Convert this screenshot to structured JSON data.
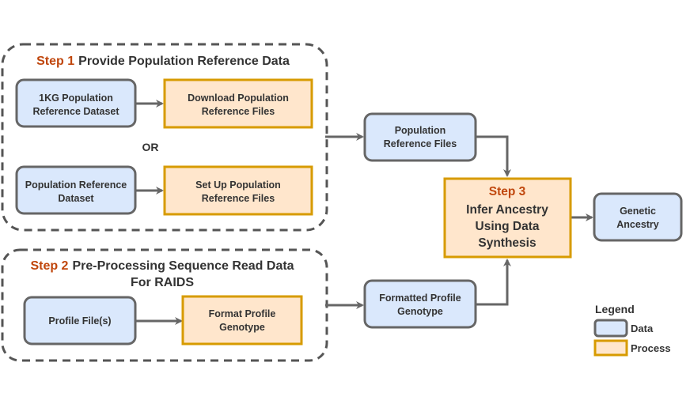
{
  "groups": {
    "step1": {
      "step": "Step 1",
      "title": "Provide Population Reference Data",
      "or_label": "OR"
    },
    "step2": {
      "step": "Step 2",
      "title_line1": "Pre-Processing Sequence Read Data",
      "title_line2": "For RAIDS"
    }
  },
  "nodes": {
    "kg_dataset": {
      "type": "data",
      "lines": [
        "1KG Population",
        "Reference Dataset"
      ]
    },
    "download_files": {
      "type": "process",
      "lines": [
        "Download Population",
        "Reference Files"
      ]
    },
    "pop_dataset": {
      "type": "data",
      "lines": [
        "Population Reference",
        "Dataset"
      ]
    },
    "setup_files": {
      "type": "process",
      "lines": [
        "Set Up Population",
        "Reference Files"
      ]
    },
    "profile_files": {
      "type": "data",
      "lines": [
        "Profile File(s)"
      ]
    },
    "format_genotype": {
      "type": "process",
      "lines": [
        "Format Profile",
        "Genotype"
      ]
    },
    "pop_ref_files": {
      "type": "data",
      "lines": [
        "Population",
        "Reference Files"
      ]
    },
    "formatted_genotype": {
      "type": "data",
      "lines": [
        "Formatted Profile",
        "Genotype"
      ]
    },
    "infer_ancestry": {
      "type": "process",
      "step": "Step 3",
      "lines": [
        "Infer Ancestry",
        "Using Data",
        "Synthesis"
      ]
    },
    "genetic_ancestry": {
      "type": "data",
      "lines": [
        "Genetic",
        "Ancestry"
      ]
    }
  },
  "legend": {
    "title": "Legend",
    "items": [
      {
        "label": "Data",
        "type": "data"
      },
      {
        "label": "Process",
        "type": "process"
      }
    ]
  },
  "colors": {
    "data_fill": "#dae8fc",
    "data_stroke": "#666666",
    "process_fill": "#ffe6cc",
    "process_stroke": "#d79b00",
    "step_accent": "#c0460c"
  }
}
